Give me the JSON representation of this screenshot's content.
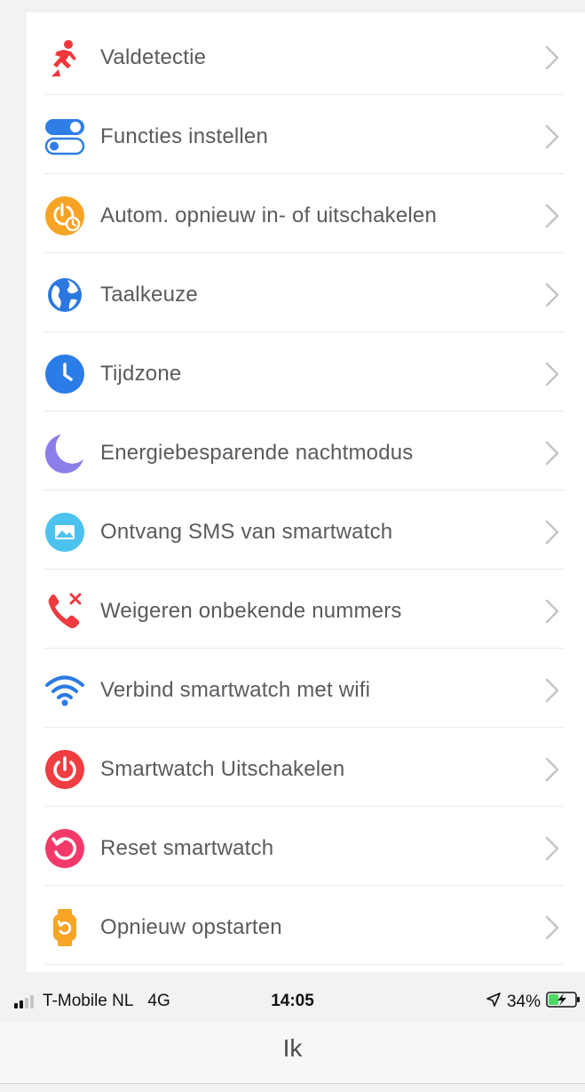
{
  "settings": {
    "items": [
      {
        "label": "Valdetectie",
        "icon": "fall-detection-icon",
        "color": "#f0373c"
      },
      {
        "label": "Functies instellen",
        "icon": "toggle-settings-icon",
        "color": "#2f7ee6"
      },
      {
        "label": "Autom. opnieuw in- of uitschakelen",
        "icon": "auto-power-schedule-icon",
        "color": "#f7a325"
      },
      {
        "label": "Taalkeuze",
        "icon": "globe-icon",
        "color": "#2c78e0"
      },
      {
        "label": "Tijdzone",
        "icon": "clock-icon",
        "color": "#2c7ce8"
      },
      {
        "label": "Energiebesparende nachtmodus",
        "icon": "moon-icon",
        "color": "#8b7ee8"
      },
      {
        "label": "Ontvang SMS van smartwatch",
        "icon": "sms-message-icon",
        "color": "#4cc2ee"
      },
      {
        "label": "Weigeren onbekende nummers",
        "icon": "reject-call-icon",
        "color": "#ee3a40"
      },
      {
        "label": "Verbind smartwatch met wifi",
        "icon": "wifi-icon",
        "color": "#2b7ae4"
      },
      {
        "label": "Smartwatch Uitschakelen",
        "icon": "power-icon",
        "color": "#ef3d42"
      },
      {
        "label": "Reset smartwatch",
        "icon": "reset-icon",
        "color": "#f2396a"
      },
      {
        "label": "Opnieuw opstarten",
        "icon": "restart-watch-icon",
        "color": "#f6a524"
      }
    ]
  },
  "status_bar": {
    "carrier": "T-Mobile NL",
    "network": "4G",
    "time": "14:05",
    "battery": "34%"
  },
  "nav": {
    "title": "Ik"
  }
}
